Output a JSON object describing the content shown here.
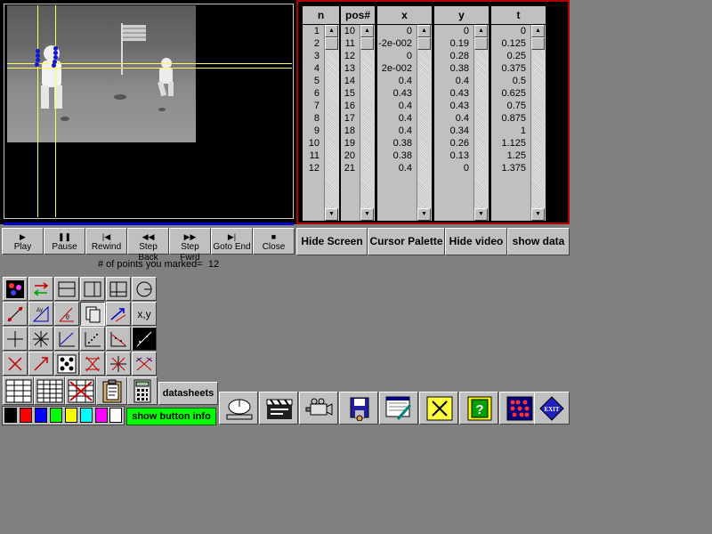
{
  "table": {
    "columns": [
      "n",
      "pos#",
      "x",
      "y",
      "t"
    ],
    "rows": [
      [
        "1",
        "10",
        "0",
        "0",
        "0"
      ],
      [
        "2",
        "11",
        "-2e-002",
        "0.19",
        "0.125"
      ],
      [
        "3",
        "12",
        "0",
        "0.28",
        "0.25"
      ],
      [
        "4",
        "13",
        "2e-002",
        "0.38",
        "0.375"
      ],
      [
        "5",
        "14",
        "0.4",
        "0.4",
        "0.5"
      ],
      [
        "6",
        "15",
        "0.43",
        "0.43",
        "0.625"
      ],
      [
        "7",
        "16",
        "0.4",
        "0.43",
        "0.75"
      ],
      [
        "8",
        "17",
        "0.4",
        "0.4",
        "0.875"
      ],
      [
        "9",
        "18",
        "0.4",
        "0.34",
        "1"
      ],
      [
        "10",
        "19",
        "0.38",
        "0.26",
        "1.125"
      ],
      [
        "11",
        "20",
        "0.38",
        "0.13",
        "1.25"
      ],
      [
        "12",
        "21",
        "0.4",
        "0",
        "1.375"
      ]
    ]
  },
  "controls": [
    {
      "label": "Play",
      "icon": "▶"
    },
    {
      "label": "Pause",
      "icon": "❚❚"
    },
    {
      "label": "Rewind",
      "icon": "|◀"
    },
    {
      "label": "Step Back",
      "icon": "◀◀"
    },
    {
      "label": "Step Fwrd",
      "icon": "▶▶"
    },
    {
      "label": "Goto End",
      "icon": "▶|"
    },
    {
      "label": "Close",
      "icon": "■"
    }
  ],
  "actions": {
    "hide_screen": "Hide Screen",
    "cursor_palette": "Cursor Palette",
    "hide_video": "Hide video",
    "show_data": "show data"
  },
  "status": {
    "marked_label": "# of points you marked=",
    "marked_count": "12"
  },
  "toolbox": {
    "xy_label": "x,y",
    "datasheets": "datasheets",
    "show_button_info": "show button info",
    "exit_label": "EXIT"
  },
  "palette_colors": [
    "#000000",
    "#ff0000",
    "#0000ff",
    "#00ff00",
    "#ffff00",
    "#00ffff",
    "#ff00ff",
    "#ffffff"
  ]
}
